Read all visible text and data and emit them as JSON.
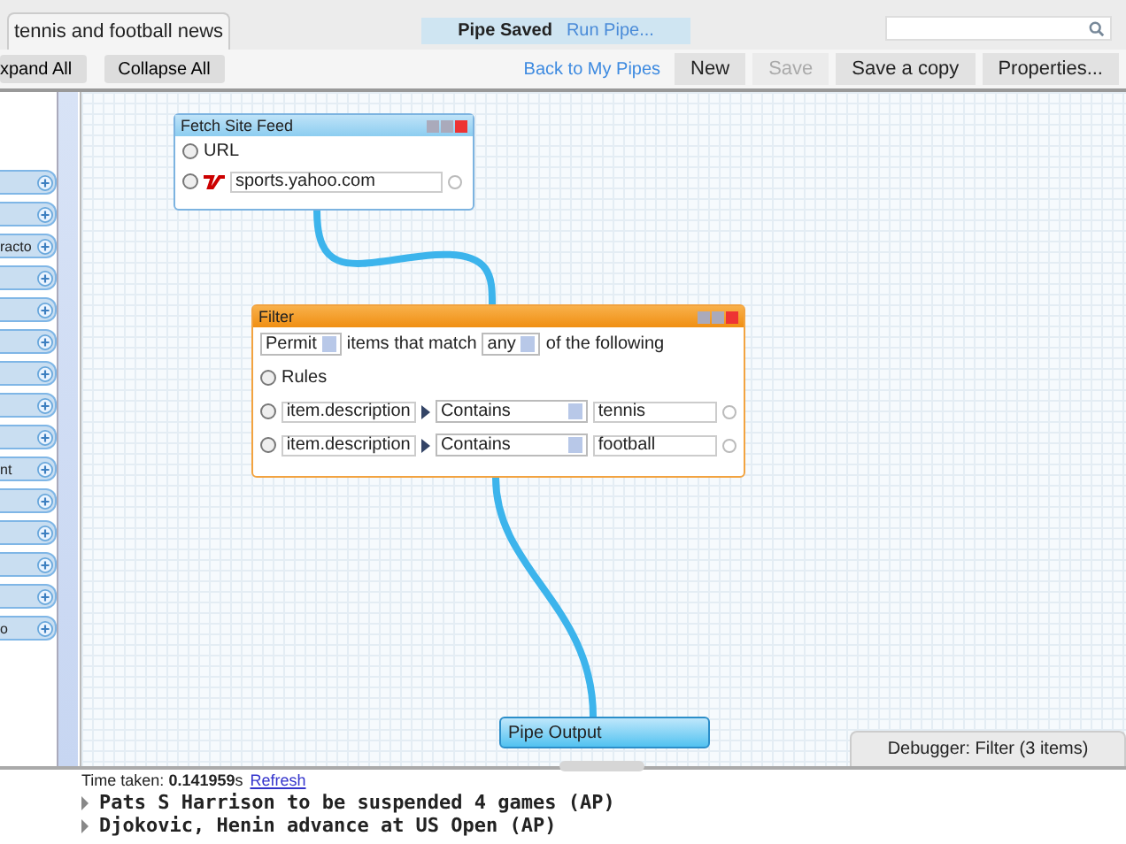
{
  "pipe_tab": {
    "title": "tennis and football news"
  },
  "status": {
    "message": "Pipe Saved",
    "link": "Run Pipe..."
  },
  "toolbar": {
    "tree_buttons": [
      "xpand All",
      "Collapse All"
    ],
    "link": "Back to My Pipes",
    "buttons": [
      {
        "label": "New",
        "disabled": false
      },
      {
        "label": "Save",
        "disabled": true
      },
      {
        "label": "Save a copy",
        "disabled": false
      },
      {
        "label": "Properties...",
        "disabled": false
      }
    ]
  },
  "sidebar": {
    "items": [
      {
        "kind": "plain"
      },
      {
        "kind": "plain"
      },
      {
        "kind": "labeled",
        "label": "racto"
      },
      {
        "kind": "plain"
      },
      {
        "kind": "plain"
      },
      {
        "kind": "plain"
      },
      {
        "kind": "plain"
      },
      {
        "kind": "plain"
      },
      {
        "kind": "plain"
      },
      {
        "kind": "labeled",
        "label": "nt"
      },
      {
        "kind": "plain"
      },
      {
        "kind": "plain"
      },
      {
        "kind": "plain"
      },
      {
        "kind": "plain"
      },
      {
        "kind": "labeled",
        "label": "o"
      }
    ]
  },
  "fetch": {
    "title": "Fetch Site Feed",
    "option": "URL",
    "url": "sports.yahoo.com"
  },
  "filter": {
    "title": "Filter",
    "mode": "Permit",
    "match_text": "items that match",
    "match": "any",
    "tail": "of the following",
    "rules_label": "Rules",
    "rules": [
      {
        "field": "item.description",
        "op": "Contains",
        "value": "tennis"
      },
      {
        "field": "item.description",
        "op": "Contains",
        "value": "football"
      }
    ]
  },
  "output": {
    "title": "Pipe Output"
  },
  "debugger": {
    "tab": "Debugger: Filter (3 items)",
    "time": "Time taken: **0.141959**s",
    "refresh": "Refresh",
    "items": [
      "Pats S Harrison to be suspended 4 games (AP)",
      "Djokovic, Henin advance at US Open (AP)"
    ]
  }
}
